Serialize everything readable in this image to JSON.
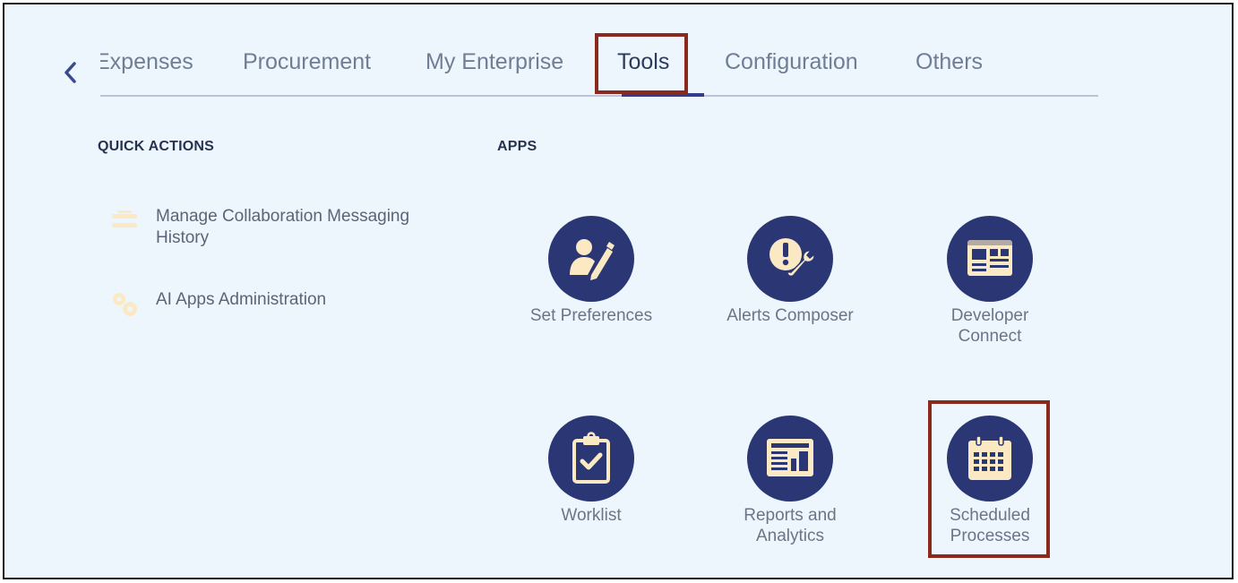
{
  "tabs": [
    {
      "label": "Expenses"
    },
    {
      "label": "Procurement"
    },
    {
      "label": "My Enterprise"
    },
    {
      "label": "Tools"
    },
    {
      "label": "Configuration"
    },
    {
      "label": "Others"
    }
  ],
  "active_tab": "Tools",
  "quick_actions": {
    "heading": "QUICK ACTIONS",
    "items": [
      {
        "label": "Manage Collaboration Messaging History",
        "icon": "list-icon"
      },
      {
        "label": "AI Apps Administration",
        "icon": "gears-icon"
      }
    ]
  },
  "apps": {
    "heading": "APPS",
    "items": [
      {
        "label": "Set Preferences",
        "icon": "user-edit-icon"
      },
      {
        "label": "Alerts Composer",
        "icon": "alert-wrench-icon"
      },
      {
        "label": "Developer Connect",
        "icon": "developer-connect-icon"
      },
      {
        "label": "Worklist",
        "icon": "clipboard-check-icon"
      },
      {
        "label": "Reports and Analytics",
        "icon": "reports-icon"
      },
      {
        "label": "Scheduled Processes",
        "icon": "calendar-icon"
      }
    ]
  },
  "colors": {
    "background": "#edf6fc",
    "app_circle": "#2b3774",
    "icon_fill": "#fbe9c4",
    "highlight": "#8a2a1e",
    "active_underline": "#343c8c"
  }
}
